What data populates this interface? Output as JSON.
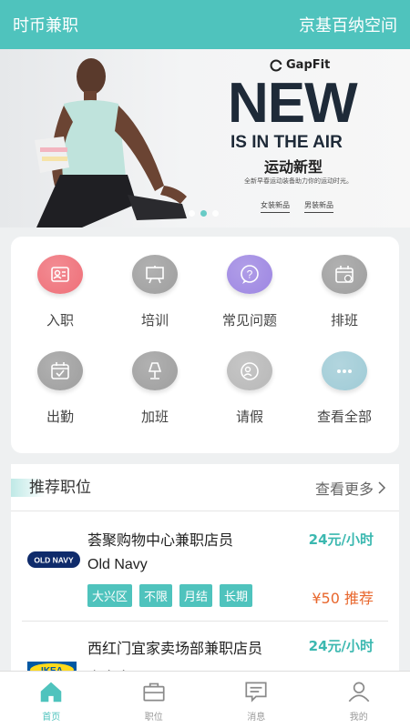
{
  "header": {
    "title": "时币兼职",
    "location": "京基百纳空间"
  },
  "banner": {
    "brand": "GapFit",
    "headline": "NEW",
    "subline": "IS IN THE AIR",
    "subline_cn": "运动新型",
    "tagline": "全新早春运动装备助力你的运动时光。",
    "links": [
      "女装新品",
      "男装新品"
    ],
    "slide_count": 3,
    "active_slide": 1
  },
  "grid": [
    {
      "label": "入职",
      "icon": "onboard-icon",
      "color": "#ef6f78"
    },
    {
      "label": "培训",
      "icon": "training-icon",
      "color": "#9e9e9e"
    },
    {
      "label": "常见问题",
      "icon": "faq-icon",
      "color": "#9d86e2"
    },
    {
      "label": "排班",
      "icon": "schedule-icon",
      "color": "#9e9e9e"
    },
    {
      "label": "出勤",
      "icon": "attendance-icon",
      "color": "#9e9e9e"
    },
    {
      "label": "加班",
      "icon": "overtime-icon",
      "color": "#9e9e9e"
    },
    {
      "label": "请假",
      "icon": "leave-icon",
      "color": "#b8b8b8"
    },
    {
      "label": "查看全部",
      "icon": "more-icon",
      "color": "#9fcbd6"
    }
  ],
  "jobs": {
    "title": "推荐职位",
    "more": "查看更多",
    "items": [
      {
        "name": "荟聚购物中心兼职店员",
        "company": "Old Navy",
        "logo_text": "OLD NAVY",
        "pay": "24元/小时",
        "tags": [
          "大兴区",
          "不限",
          "月结",
          "长期"
        ],
        "bonus": "¥50 推荐"
      },
      {
        "name": "西红门宜家卖场部兼职店员",
        "company": "宜家家居",
        "logo_text": "IKEA",
        "pay": "24元/小时",
        "tags": [],
        "bonus": ""
      }
    ]
  },
  "tabs": [
    {
      "label": "首页",
      "icon": "home-icon",
      "active": true
    },
    {
      "label": "职位",
      "icon": "briefcase-icon",
      "active": false
    },
    {
      "label": "消息",
      "icon": "message-icon",
      "active": false
    },
    {
      "label": "我的",
      "icon": "profile-icon",
      "active": false
    }
  ],
  "colors": {
    "accent": "#4fc3bd",
    "bonus": "#e8672d"
  }
}
